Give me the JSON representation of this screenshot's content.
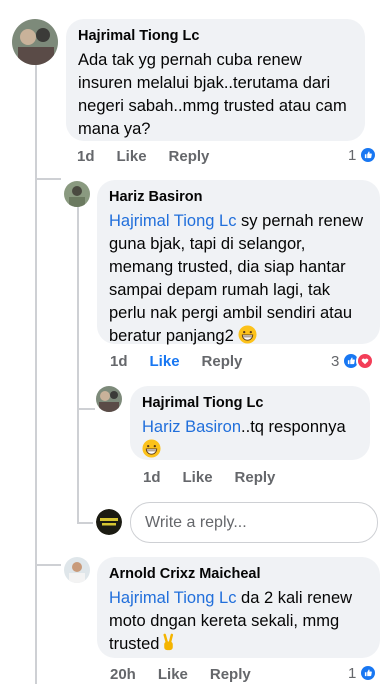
{
  "colors": {
    "accent": "#1877f2",
    "mention": "#216fdb",
    "bubble": "#f0f2f5",
    "meta_text": "#65676b",
    "thread_line": "#ced0d4"
  },
  "comments": [
    {
      "author": "Hajrimal Tiong Lc",
      "text": "Ada tak yg pernah cuba renew insuren melalui bjak..terutama dari negeri sabah..mmg trusted atau cam mana ya?",
      "time": "1d",
      "like_label": "Like",
      "reply_label": "Reply",
      "reaction_count": "1",
      "reaction_icons": [
        "like-icon"
      ]
    },
    {
      "author": "Hariz Basiron",
      "mention": "Hajrimal Tiong Lc",
      "text": " sy pernah renew guna bjak, tapi di selangor, memang trusted, dia siap hantar sampai depam rumah lagi, tak perlu nak pergi ambil sendiri atau beratur panjang2 ",
      "emoji": "grinning-face-emoji",
      "time": "1d",
      "like_label": "Like",
      "liked": true,
      "reply_label": "Reply",
      "reaction_count": "3",
      "reaction_icons": [
        "like-icon",
        "love-icon"
      ]
    },
    {
      "author": "Hajrimal Tiong Lc",
      "mention": "Hariz Basiron",
      "text": "..tq responnya",
      "emoji": "grinning-face-emoji",
      "time": "1d",
      "like_label": "Like",
      "reply_label": "Reply"
    },
    {
      "author": "Arnold Crixz Maicheal",
      "mention": "Hajrimal Tiong Lc",
      "text": " da 2 kali renew moto dngan kereta sekali, mmg trusted",
      "emoji": "victory-hand-emoji",
      "time": "20h",
      "like_label": "Like",
      "reply_label": "Reply",
      "reaction_count": "1",
      "reaction_icons": [
        "like-icon"
      ]
    }
  ],
  "reply_box": {
    "placeholder": "Write a reply..."
  }
}
